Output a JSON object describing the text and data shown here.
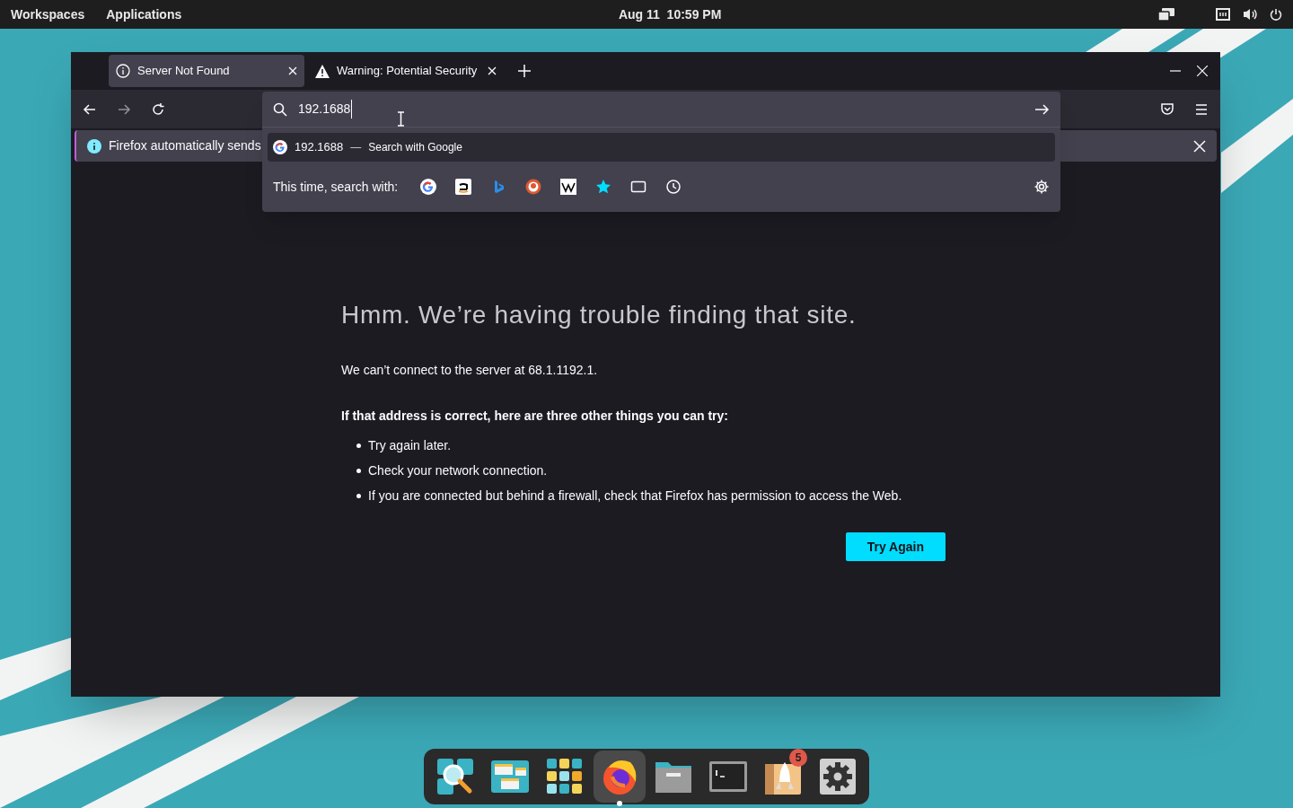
{
  "top_bar": {
    "menus": [
      "Workspaces",
      "Applications"
    ],
    "clock": "Aug 11  10:59 PM"
  },
  "tabs": [
    {
      "label": "Server Not Found",
      "kind": "info",
      "selected": true
    },
    {
      "label": "Warning: Potential Security",
      "kind": "warning",
      "selected": false
    }
  ],
  "address_bar": {
    "value": "192.1688"
  },
  "suggestion": {
    "query": "192.1688",
    "separator": "—",
    "action": "Search with Google"
  },
  "search_with": {
    "label": "This time, search with:"
  },
  "notification": {
    "text": "Firefox automatically sends"
  },
  "error_page": {
    "title": "Hmm. We’re having trouble finding that site.",
    "message": "We can’t connect to the server at 68.1.1192.1.",
    "subheading": "If that address is correct, here are three other things you can try:",
    "suggestions": [
      "Try again later.",
      "Check your network connection.",
      "If you are connected but behind a firewall, check that Firefox has permission to access the Web."
    ],
    "button": "Try Again"
  },
  "dock": [
    {
      "kind": "search",
      "selected": false
    },
    {
      "kind": "windows",
      "selected": false
    },
    {
      "kind": "apps",
      "selected": false
    },
    {
      "kind": "browser",
      "selected": true
    },
    {
      "kind": "files",
      "selected": false
    },
    {
      "kind": "terminal",
      "selected": false
    },
    {
      "kind": "launcher",
      "selected": false,
      "badge": "5"
    },
    {
      "kind": "settings",
      "selected": false
    }
  ]
}
